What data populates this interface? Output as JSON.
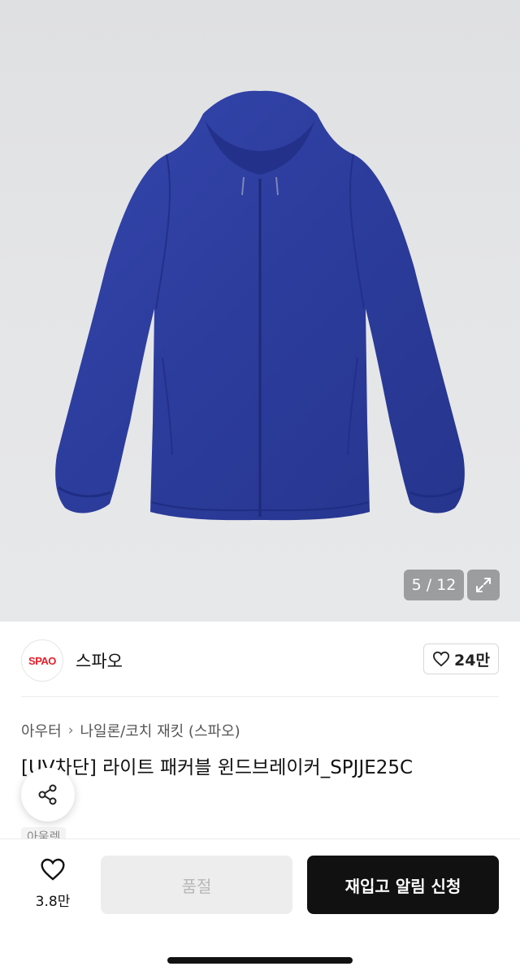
{
  "gallery": {
    "counter": "5 / 12",
    "expand_icon": "expand-icon"
  },
  "brand": {
    "logo_text": "SPAO",
    "name": "스파오",
    "like_count": "24만"
  },
  "product": {
    "breadcrumb": [
      "아우터",
      "나일론/코치 재킷 (스파오)"
    ],
    "title": "[UV차단] 라이트 패커블 윈드브레이커_SPJJE25C",
    "tag": "아울렛"
  },
  "bottom_bar": {
    "wish_count": "3.8만",
    "soldout_label": "품절",
    "restock_label": "재입고 알림 신청"
  },
  "colors": {
    "jacket": "#2f3fa0",
    "brand_red": "#e4202b",
    "primary_button": "#111111",
    "disabled_button": "#ededed"
  }
}
